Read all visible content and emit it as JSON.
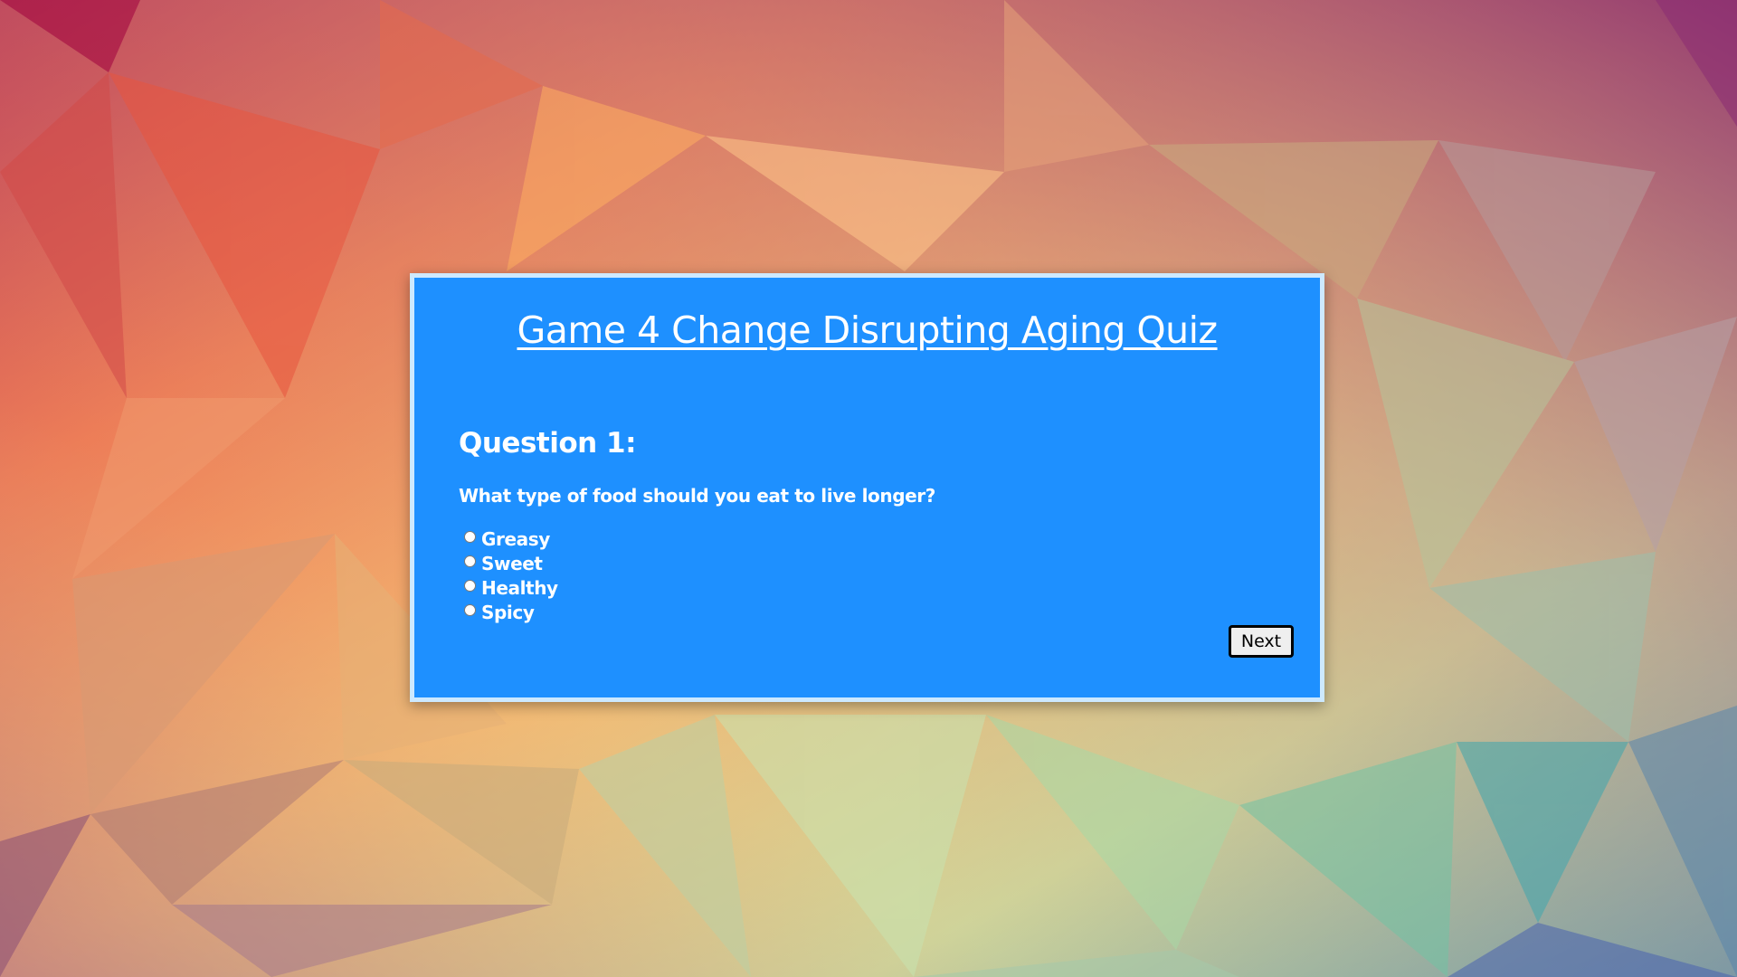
{
  "quiz": {
    "title": "Game 4 Change Disrupting Aging Quiz",
    "question_heading": "Question 1:",
    "question_text": "What type of food should you eat to live longer?",
    "options": [
      {
        "label": "Greasy",
        "checked": false
      },
      {
        "label": "Sweet",
        "checked": false
      },
      {
        "label": "Healthy",
        "checked": false
      },
      {
        "label": "Spicy",
        "checked": false
      }
    ],
    "next_label": "Next"
  },
  "colors": {
    "card_background": "#1e90ff",
    "card_border": "#cde9ff",
    "text": "#ffffff",
    "button_background": "#efefef",
    "button_border": "#000000"
  }
}
